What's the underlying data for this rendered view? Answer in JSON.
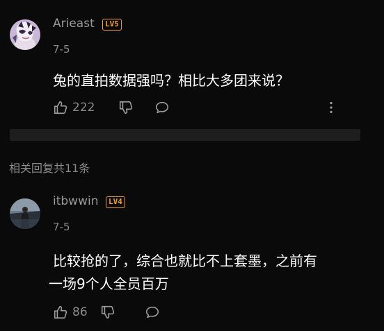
{
  "comments": [
    {
      "username": "Arieast",
      "level": "LV5",
      "date": "7-5",
      "content": "兔的直拍数据强吗？相比大多团来说？",
      "like_count": "222"
    },
    {
      "username": "itbwwin",
      "level": "LV4",
      "date": "7-5",
      "content_line1": "比较抢的了，综合也就比不上套墨，之前有",
      "content_line2": "一场9个人全员百万",
      "like_count": "86"
    }
  ],
  "replies_header": "相关回复共11条",
  "colors": {
    "background": "#0a0a0a",
    "level_badge": "#f0a020",
    "muted_text": "#8a8a8a",
    "divider": "#1e1e1e"
  },
  "icons": [
    "thumbs-up-icon",
    "thumbs-down-icon",
    "comment-bubble-icon",
    "more-vertical-icon"
  ]
}
